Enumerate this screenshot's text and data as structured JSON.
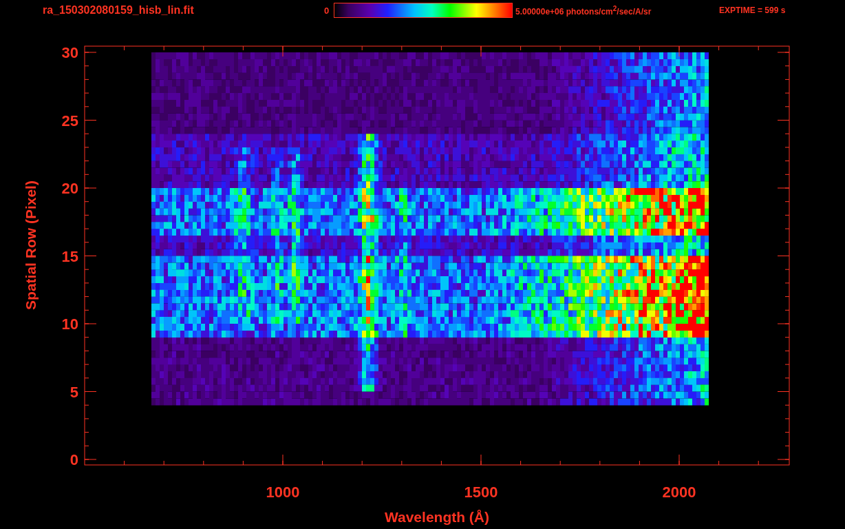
{
  "header": {
    "title": "ra_150302080159_hisb_lin.fit",
    "colorbar_min": "0",
    "colorbar_max": "5.00000e+06 photons/cm$^{2}$/sec/A/sr",
    "exposure": "EXPTIME = 599 s"
  },
  "x_axis": {
    "label": "Wavelength (Å)",
    "ticks": [
      "1000",
      "1500",
      "2000"
    ]
  },
  "y_axis": {
    "label": "Spatial Row (Pixel)",
    "ticks": [
      "30",
      "25",
      "20",
      "15",
      "10",
      "5",
      "0"
    ]
  }
}
